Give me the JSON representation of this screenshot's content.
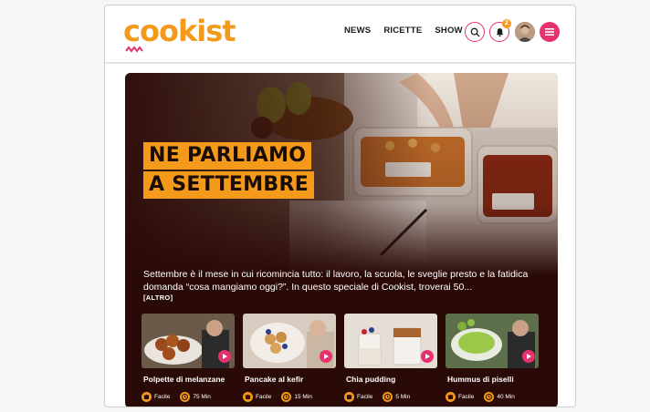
{
  "brand": {
    "logo_text": "cookist",
    "accent": "#f39a1b",
    "pink": "#e6316f"
  },
  "nav": {
    "items": [
      "NEWS",
      "RICETTE",
      "SHOW"
    ]
  },
  "header_icons": {
    "search": "search-icon",
    "notifications": "bell-icon",
    "notification_count": "2",
    "avatar": "user-avatar",
    "menu": "menu-icon"
  },
  "hero": {
    "headline_line1": "NE PARLIAMO",
    "headline_line2": "A SETTEMBRE",
    "description": "Settembre è il mese in cui ricomincia tutto: il lavoro, la scuola, le sveglie presto e la fatidica domanda “cosa mangiamo oggi?”. In questo speciale di Cookist, troverai 50...",
    "more_label": "[ALTRO]"
  },
  "cards": [
    {
      "title": "Polpette di melanzane",
      "difficulty": "Facile",
      "time": "75 Min"
    },
    {
      "title": "Pancake al kefir",
      "difficulty": "Facile",
      "time": "15 Min"
    },
    {
      "title": "Chia pudding",
      "difficulty": "Facile",
      "time": "5 Min"
    },
    {
      "title": "Hummus di piselli",
      "difficulty": "Facile",
      "time": "40 Min"
    }
  ]
}
